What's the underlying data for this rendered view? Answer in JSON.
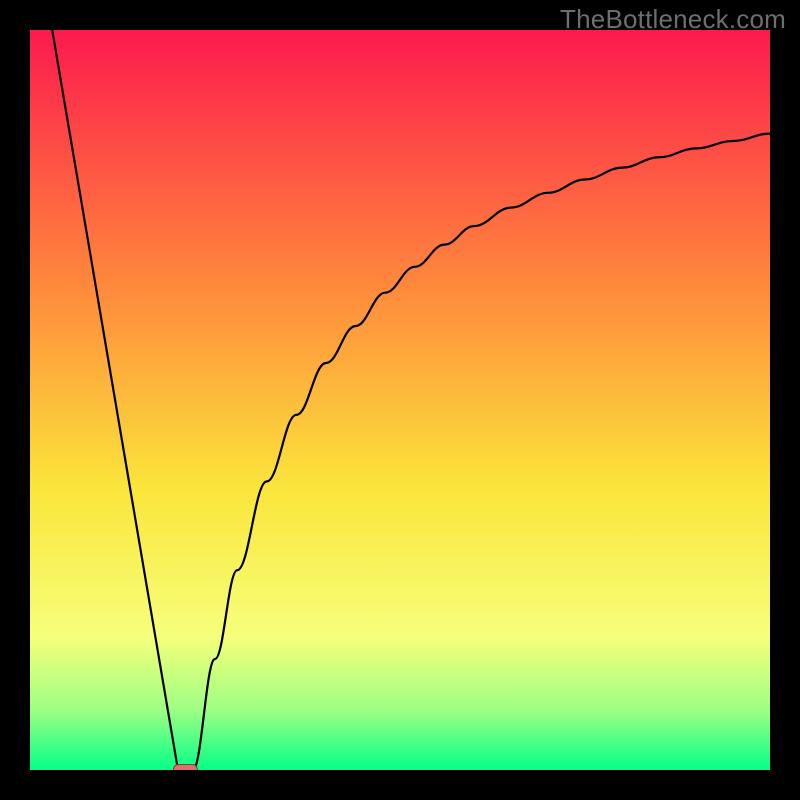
{
  "watermark": "TheBottleneck.com",
  "colors": {
    "gradient_top": "#fc1a4d",
    "gradient_upper": "#ff8a3c",
    "gradient_mid": "#fbe53b",
    "gradient_low": "#f6ff7a",
    "gradient_lower": "#9cff84",
    "gradient_bottom": "#06ff87",
    "curve": "#000000",
    "marker_fill": "#d9726a",
    "marker_stroke": "#7d413b"
  },
  "chart_data": {
    "type": "line",
    "title": "",
    "xlabel": "",
    "ylabel": "",
    "xlim": [
      0,
      100
    ],
    "ylim": [
      0,
      100
    ],
    "grid": false,
    "legend": false,
    "series": [
      {
        "name": "left-branch",
        "x": [
          3.0,
          20.0
        ],
        "y": [
          100,
          0
        ]
      },
      {
        "name": "right-branch",
        "x": [
          22,
          25,
          28,
          32,
          36,
          40,
          44,
          48,
          52,
          56,
          60,
          65,
          70,
          75,
          80,
          85,
          90,
          95,
          100
        ],
        "y": [
          0,
          15,
          27,
          39,
          48,
          55,
          60,
          64.5,
          68,
          71,
          73.5,
          76,
          78,
          79.8,
          81.4,
          82.8,
          84,
          85,
          86
        ]
      }
    ],
    "marker": {
      "name": "optimum-point",
      "x": 21,
      "y": 0,
      "shape": "rounded-rect"
    }
  }
}
